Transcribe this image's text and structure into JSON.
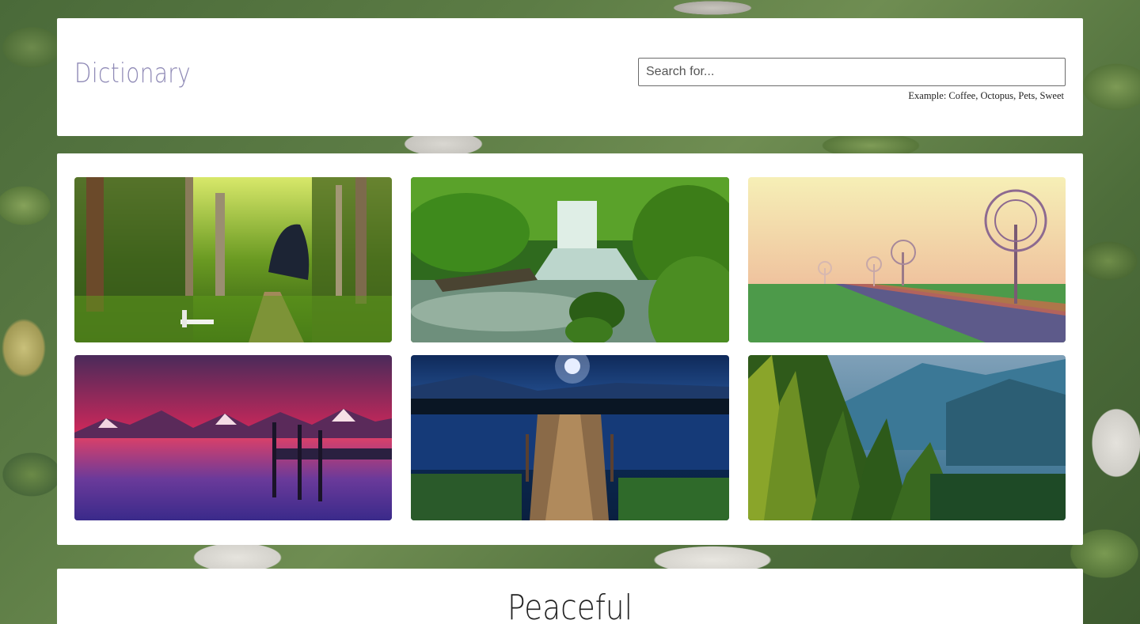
{
  "app": {
    "title": "Dictionary"
  },
  "search": {
    "placeholder": "Search for...",
    "value": "",
    "example": "Example: Coffee, Octopus, Pets, Sweet"
  },
  "gallery": {
    "photos": [
      {
        "name": "forest-path-with-bench-photo",
        "icon": "forest-path"
      },
      {
        "name": "waterfall-stream-photo",
        "icon": "waterfall"
      },
      {
        "name": "foggy-road-trees-photo",
        "icon": "foggy-road"
      },
      {
        "name": "sunset-mountain-lake-photo",
        "icon": "sunset-lake"
      },
      {
        "name": "moonlit-lake-pier-photo",
        "icon": "moon-pier"
      },
      {
        "name": "pine-forest-valley-photo",
        "icon": "pine-valley"
      }
    ]
  },
  "result": {
    "word": "Peaceful"
  }
}
